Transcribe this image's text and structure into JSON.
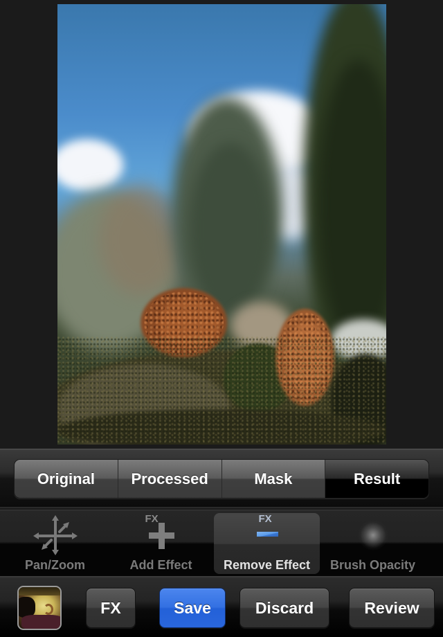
{
  "photo": {
    "description": "Edited photo preview: blurred sky, clouds and trees with sharp foreground hedge and copper beech bushes"
  },
  "view_modes": {
    "items": [
      {
        "label": "Original",
        "selected": false
      },
      {
        "label": "Processed",
        "selected": false
      },
      {
        "label": "Mask",
        "selected": false
      },
      {
        "label": "Result",
        "selected": true
      }
    ]
  },
  "tools": {
    "items": [
      {
        "label": "Pan/Zoom",
        "icon": "pan-zoom-icon",
        "active": false
      },
      {
        "label": "Add Effect",
        "icon": "fx-plus-icon",
        "badge": "FX",
        "active": false
      },
      {
        "label": "Remove Effect",
        "icon": "fx-minus-icon",
        "badge": "FX",
        "active": true
      },
      {
        "label": "Brush Opacity",
        "icon": "soft-brush-icon",
        "active": false
      }
    ]
  },
  "bottom_bar": {
    "thumbnail_icon": "photo-thumbnail",
    "fx_label": "FX",
    "save_label": "Save",
    "discard_label": "Discard",
    "review_label": "Review"
  },
  "colors": {
    "accent_blue": "#3370e2",
    "remove_bar_blue": "#5b9be8",
    "background": "#1b1b1b"
  }
}
